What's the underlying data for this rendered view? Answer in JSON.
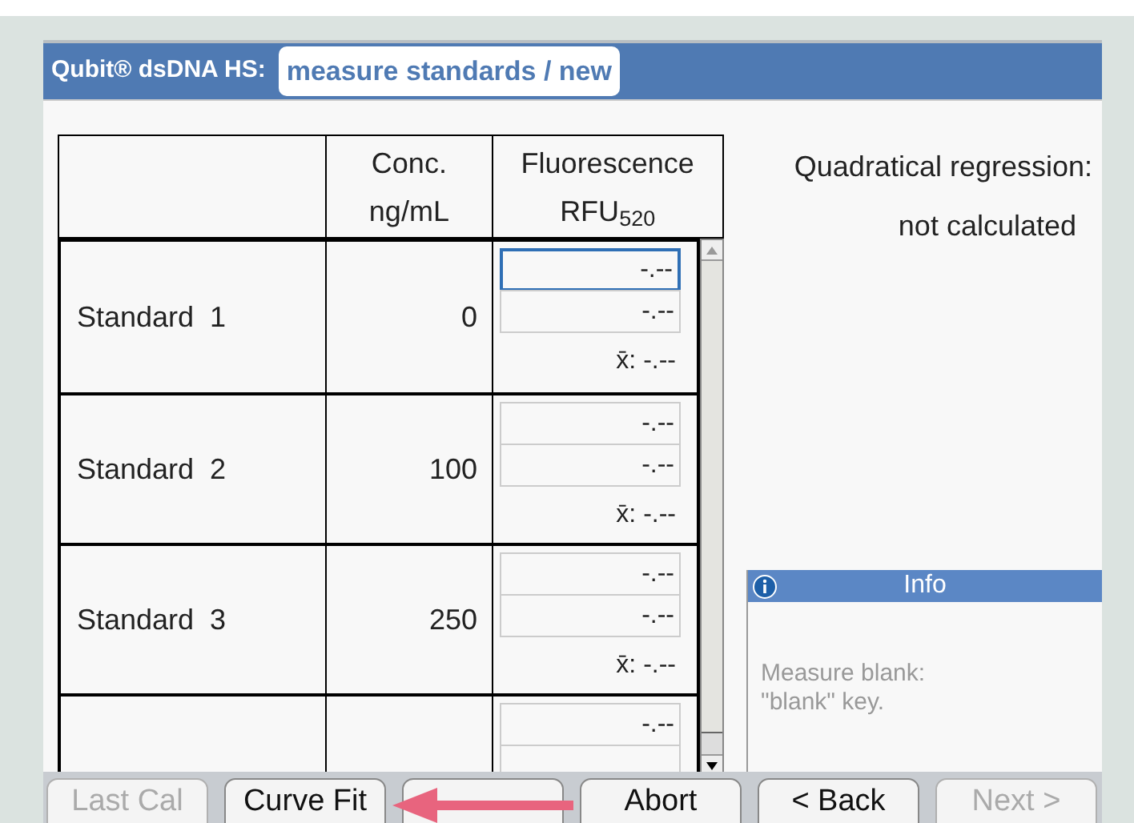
{
  "header": {
    "title": "Qubit® dsDNA HS:",
    "mode": "measure standards / new"
  },
  "table": {
    "columns": [
      "",
      "Conc.\nng/mL",
      "Fluorescence\nRFU$_{520}$"
    ],
    "rows": [
      {
        "name": "Standard  1",
        "conc": "0",
        "readings": [
          {
            "value": "-.--",
            "focused": true
          },
          {
            "value": "-.--",
            "focused": false
          }
        ],
        "mean": "x̄: -.--"
      },
      {
        "name": "Standard  2",
        "conc": "100",
        "readings": [
          {
            "value": "-.--",
            "focused": false
          },
          {
            "value": "-.--",
            "focused": false
          }
        ],
        "mean": "x̄: -.--"
      },
      {
        "name": "Standard  3",
        "conc": "250",
        "readings": [
          {
            "value": "-.--",
            "focused": false
          },
          {
            "value": "-.--",
            "focused": false
          }
        ],
        "mean": "x̄: -.--"
      },
      {
        "readings": [
          {
            "value": "-.--",
            "focused": false
          }
        ]
      }
    ]
  },
  "regression": {
    "label": "Quadratical regression:",
    "value": "not calculated"
  },
  "info": {
    "title": "Info",
    "message": "Measure blank:\n\"blank\" key."
  },
  "buttons": [
    {
      "label": "Last Cal",
      "disabled": true
    },
    {
      "label": "Curve Fit",
      "disabled": false
    },
    {
      "disabled": false
    },
    {
      "label": "Abort",
      "disabled": false
    },
    {
      "label": "< Back",
      "disabled": false
    },
    {
      "label": "Next >",
      "disabled": true
    }
  ]
}
